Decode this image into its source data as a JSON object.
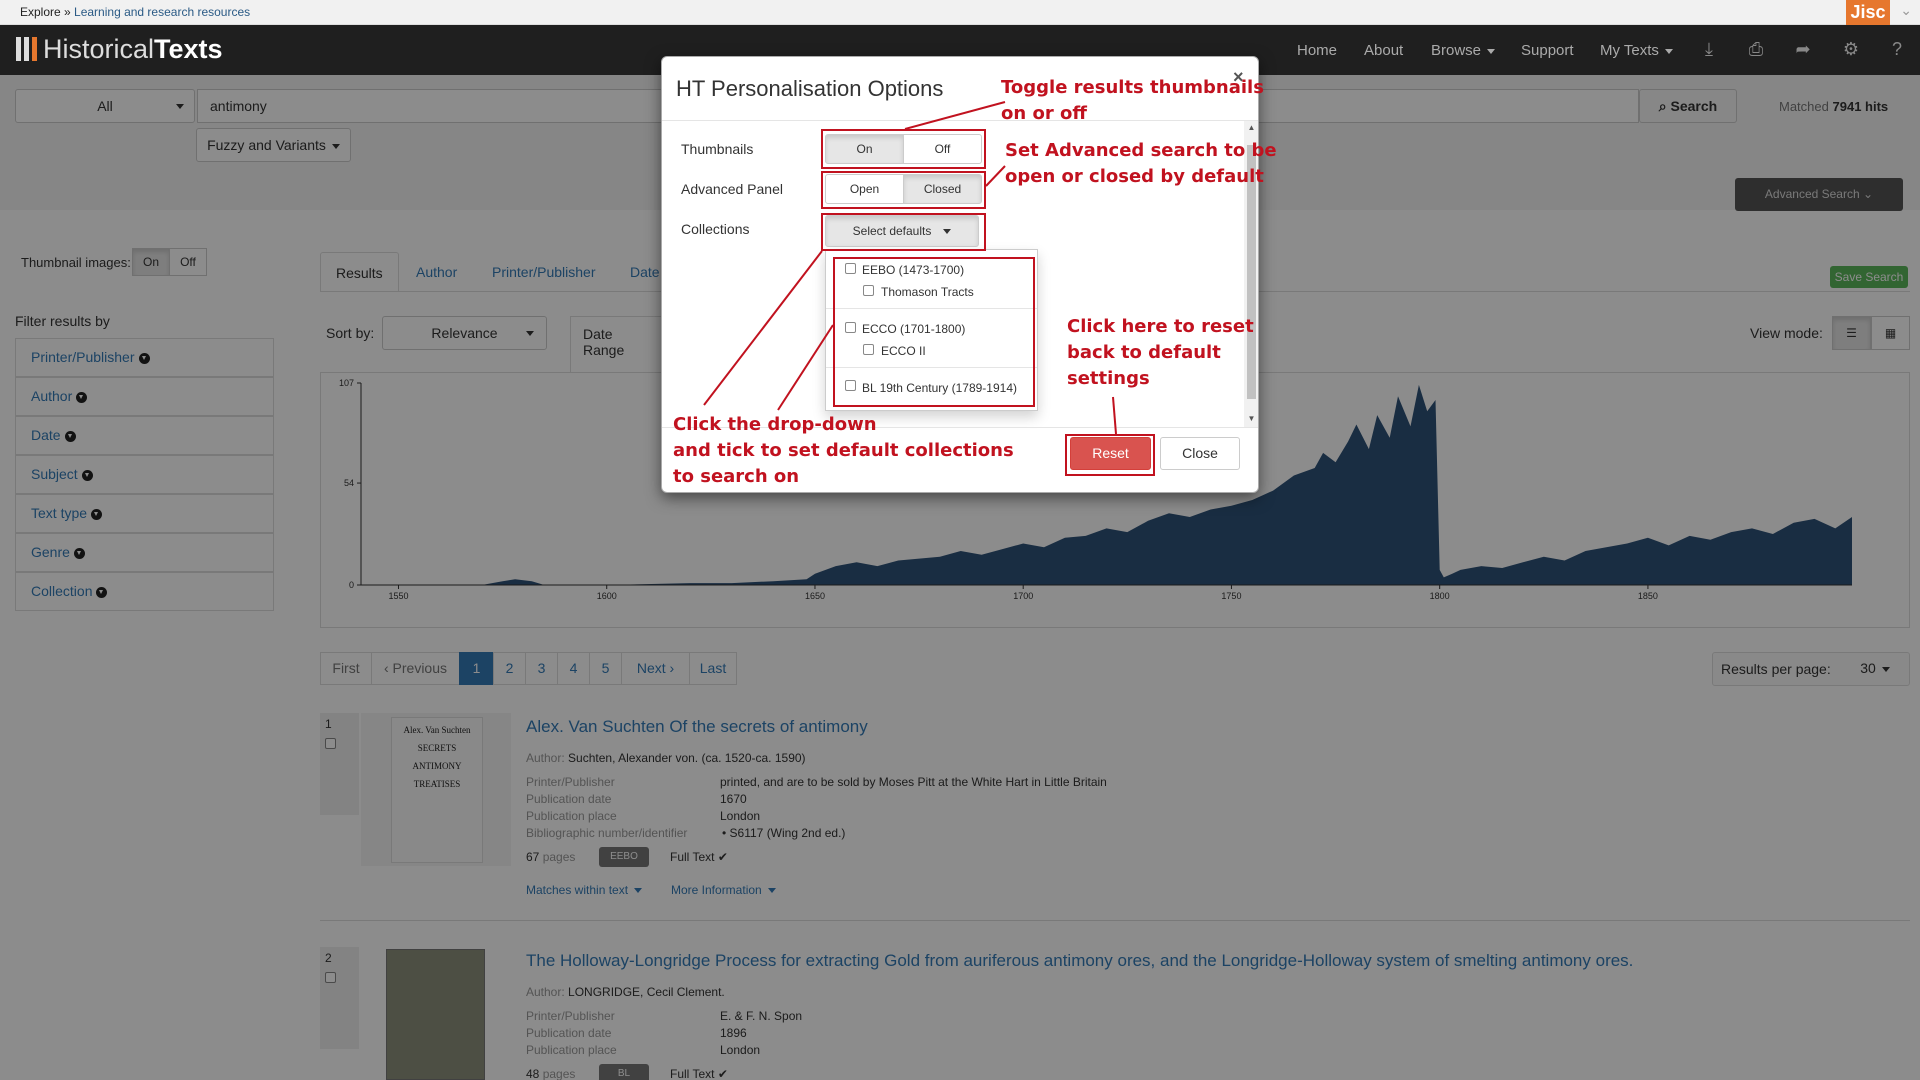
{
  "topstrip": {
    "explore": "Explore",
    "sep": " » ",
    "crumb": "Learning and research resources",
    "jisc": "Jisc"
  },
  "navbar": {
    "logo_part1": "Historical",
    "logo_part2": "Texts",
    "items": [
      "Home",
      "About",
      "Browse",
      "Support",
      "My Texts"
    ],
    "icons": [
      "download-icon",
      "print-icon",
      "share-icon",
      "gear-icon",
      "help-icon"
    ]
  },
  "search": {
    "scope": "All",
    "query": "antimony",
    "button": "Search",
    "matched_label": "Matched",
    "matched_count": "7941",
    "hits_label": "hits",
    "fuzzy": "Fuzzy and Variants",
    "advanced": "Advanced Search"
  },
  "thumbnails": {
    "label": "Thumbnail images:",
    "on": "On",
    "off": "Off"
  },
  "sidebar": {
    "title": "Filter results by",
    "items": [
      "Printer/Publisher",
      "Author",
      "Date",
      "Subject",
      "Text type",
      "Genre",
      "Collection"
    ]
  },
  "tabs": [
    "Results",
    "Author",
    "Printer/Publisher",
    "Date"
  ],
  "save_search": "Save Search",
  "sort": {
    "label": "Sort by:",
    "value": "Relevance",
    "date_range": "Date Range"
  },
  "view_mode": {
    "label": "View mode:"
  },
  "chart_data": {
    "type": "area",
    "title": "",
    "xlabel": "",
    "ylabel": "",
    "x_ticks": [
      "1550",
      "1600",
      "1650",
      "1700",
      "1750",
      "1800",
      "1850"
    ],
    "y_ticks": [
      "0",
      "54",
      "107"
    ],
    "xlim": [
      1541,
      1899
    ],
    "ylim": [
      0,
      107
    ],
    "color": "#2f5278",
    "series": [
      {
        "x": [
          1541,
          1570,
          1575,
          1578,
          1582,
          1585,
          1600,
          1620,
          1630,
          1640,
          1648,
          1650,
          1655,
          1660,
          1665,
          1670,
          1675,
          1680,
          1685,
          1690,
          1695,
          1700,
          1705,
          1710,
          1715,
          1720,
          1725,
          1730,
          1735,
          1740,
          1745,
          1750,
          1755,
          1760,
          1765,
          1770,
          1772,
          1775,
          1778,
          1780,
          1783,
          1785,
          1788,
          1790,
          1793,
          1795,
          1797,
          1799,
          1800,
          1801,
          1803,
          1805,
          1810,
          1815,
          1820,
          1825,
          1830,
          1835,
          1840,
          1845,
          1850,
          1855,
          1860,
          1865,
          1870,
          1875,
          1880,
          1885,
          1890,
          1895,
          1899
        ],
        "values": [
          0,
          0,
          2,
          3,
          2,
          0,
          0,
          1,
          1,
          2,
          3,
          6,
          10,
          12,
          10,
          13,
          14,
          15,
          18,
          16,
          19,
          22,
          20,
          25,
          26,
          30,
          28,
          34,
          38,
          36,
          40,
          42,
          45,
          50,
          58,
          62,
          70,
          65,
          76,
          85,
          72,
          90,
          78,
          100,
          84,
          106,
          92,
          98,
          8,
          4,
          6,
          8,
          10,
          9,
          12,
          15,
          13,
          18,
          20,
          22,
          25,
          21,
          26,
          24,
          28,
          30,
          27,
          33,
          35,
          30,
          36
        ]
      }
    ]
  },
  "pagination": [
    "First",
    "‹ Previous",
    "1",
    "2",
    "3",
    "4",
    "5",
    "Next ›",
    "Last"
  ],
  "per_page": {
    "label": "Results per page:",
    "value": "30"
  },
  "results": [
    {
      "num": "1",
      "title": "Alex. Van Suchten Of the secrets of antimony",
      "author_label": "Author:",
      "author": "Suchten, Alexander von. (ca. 1520-ca. 1590)",
      "fields": [
        {
          "label": "Printer/Publisher",
          "value": "printed, and are to be sold by Moses Pitt at the White Hart in Little Britain"
        },
        {
          "label": "Publication date",
          "value": "1670"
        },
        {
          "label": "Publication place",
          "value": "London"
        },
        {
          "label": "Bibliographic number/identifier",
          "value": "S6117 (Wing 2nd ed.)"
        }
      ],
      "pages_num": "67",
      "pages_label": "pages",
      "badge": "EEBO",
      "fulltext": "Full Text",
      "matches": "Matches within text",
      "more": "More Information",
      "thumb_lines": [
        "Alex. Van Suchten",
        "SECRETS",
        "ANTIMONY",
        "TREATISES"
      ]
    },
    {
      "num": "2",
      "title": "The Holloway-Longridge Process for extracting Gold from auriferous antimony ores, and the Longridge-Holloway system of smelting antimony ores.",
      "author_label": "Author:",
      "author": "LONGRIDGE, Cecil Clement.",
      "fields": [
        {
          "label": "Printer/Publisher",
          "value": "E. & F. N. Spon"
        },
        {
          "label": "Publication date",
          "value": "1896"
        },
        {
          "label": "Publication place",
          "value": "London"
        }
      ],
      "pages_num": "48",
      "pages_label": "pages",
      "badge": "BL",
      "fulltext": "Full Text"
    }
  ],
  "modal": {
    "title": "HT Personalisation Options",
    "close_x": "×",
    "thumbnails_label": "Thumbnails",
    "on": "On",
    "off": "Off",
    "advanced_label": "Advanced Panel",
    "open": "Open",
    "closed": "Closed",
    "collections_label": "Collections",
    "select_defaults": "Select defaults",
    "collections": [
      {
        "label": "EEBO (1473-1700)",
        "sub": "Thomason Tracts"
      },
      {
        "label": "ECCO (1701-1800)",
        "sub": "ECCO II"
      },
      {
        "label": "BL 19th Century (1789-1914)"
      }
    ],
    "reset": "Reset",
    "close": "Close"
  },
  "annotations": {
    "thumbnails": [
      "Toggle results thumbnails",
      "on or off"
    ],
    "advanced": [
      "Set Advanced search to be",
      "open or closed by default"
    ],
    "reset": [
      "Click here to reset",
      "back to default",
      "settings"
    ],
    "collections": [
      "Click the drop-down",
      "and tick to set default collections",
      "to search on"
    ],
    "color": "#c1121f"
  }
}
